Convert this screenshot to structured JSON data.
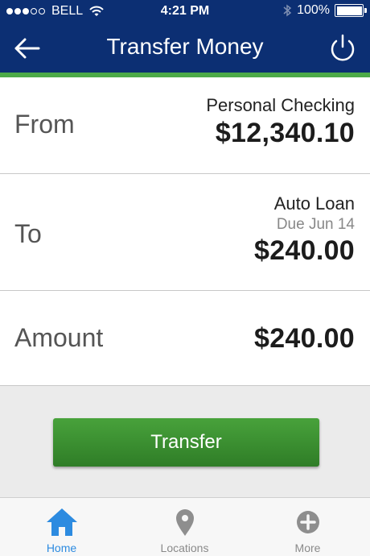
{
  "status_bar": {
    "carrier": "BELL",
    "time": "4:21 PM",
    "battery": "100%"
  },
  "nav": {
    "title": "Transfer Money"
  },
  "from": {
    "label": "From",
    "account_name": "Personal Checking",
    "amount": "$12,340.10"
  },
  "to": {
    "label": "To",
    "account_name": "Auto Loan",
    "due": "Due Jun 14",
    "amount": "$240.00"
  },
  "amount_row": {
    "label": "Amount",
    "value": "$240.00"
  },
  "transfer_button": "Transfer",
  "tabs": [
    {
      "label": "Home",
      "icon": "home-icon",
      "active": true
    },
    {
      "label": "Locations",
      "icon": "location-pin-icon",
      "active": false
    },
    {
      "label": "More",
      "icon": "plus-circle-icon",
      "active": false
    }
  ],
  "colors": {
    "header": "#0c2f73",
    "accent": "#4caa48",
    "button": "#3a8d2f",
    "active_tab": "#2d8be0"
  }
}
